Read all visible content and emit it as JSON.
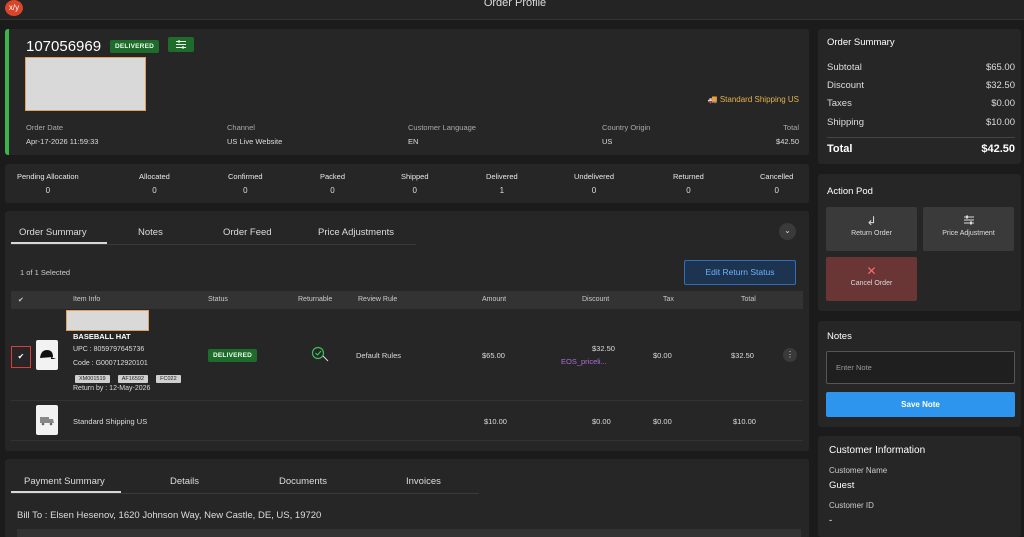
{
  "window": {
    "title": "Order Profile",
    "logo": "x/y"
  },
  "order": {
    "number": "107056969",
    "status": "DELIVERED",
    "shipping_method": "Standard Shipping US",
    "meta": [
      {
        "label": "Order Date",
        "value": "Apr-17-2026 11:59:33"
      },
      {
        "label": "Channel",
        "value": "US Live Website"
      },
      {
        "label": "Customer Language",
        "value": "EN"
      },
      {
        "label": "Country Origin",
        "value": "US"
      },
      {
        "label": "Total",
        "value": "$42.50"
      }
    ]
  },
  "counts": [
    {
      "label": "Pending Allocation",
      "value": "0"
    },
    {
      "label": "Allocated",
      "value": "0"
    },
    {
      "label": "Confirmed",
      "value": "0"
    },
    {
      "label": "Packed",
      "value": "0"
    },
    {
      "label": "Shipped",
      "value": "0"
    },
    {
      "label": "Delivered",
      "value": "1"
    },
    {
      "label": "Undelivered",
      "value": "0"
    },
    {
      "label": "Returned",
      "value": "0"
    },
    {
      "label": "Cancelled",
      "value": "0"
    }
  ],
  "main": {
    "tabs": [
      "Order Summary",
      "Notes",
      "Order Feed",
      "Price Adjustments"
    ],
    "selected_text": "1 of 1 Selected",
    "edit_return_label": "Edit Return Status",
    "columns": [
      "Item Info",
      "Status",
      "Returnable",
      "Review Rule",
      "Amount",
      "Discount",
      "Tax",
      "Total"
    ],
    "items": [
      {
        "name": "BASEBALL HAT",
        "upc": "UPC : 8059797645736",
        "code": "Code : G000712920101",
        "tags": [
          "XM001519",
          "AF16592",
          "FC022"
        ],
        "return_by": "Return by : 12-May-2026",
        "status": "DELIVERED",
        "review_rule": "Default Rules",
        "amount": "$65.00",
        "discount": "$32.50",
        "discount_note": "EOS_priceli...",
        "tax": "$0.00",
        "total": "$32.50"
      },
      {
        "name": "Standard Shipping US",
        "amount": "$10.00",
        "discount": "$0.00",
        "tax": "$0.00",
        "total": "$10.00"
      }
    ]
  },
  "payment": {
    "tabs": [
      "Payment Summary",
      "Details",
      "Documents",
      "Invoices"
    ],
    "bill_to": "Bill To : Elsen Hesenov, 1620 Johnson Way, New Castle, DE, US, 19720"
  },
  "order_summary": {
    "title": "Order Summary",
    "rows": [
      {
        "label": "Subtotal",
        "value": "$65.00"
      },
      {
        "label": "Discount",
        "value": "$32.50"
      },
      {
        "label": "Taxes",
        "value": "$0.00"
      },
      {
        "label": "Shipping",
        "value": "$10.00"
      }
    ],
    "total_label": "Total",
    "total_value": "$42.50"
  },
  "action_pod": {
    "title": "Action Pod",
    "return_order": "Return Order",
    "price_adjustment": "Price Adjustment",
    "cancel_order": "Cancel Order"
  },
  "notes": {
    "title": "Notes",
    "placeholder": "Enter Note",
    "save_label": "Save Note"
  },
  "customer": {
    "title": "Customer Information",
    "name_label": "Customer Name",
    "name_value": "Guest",
    "id_label": "Customer ID",
    "id_value": "-"
  }
}
